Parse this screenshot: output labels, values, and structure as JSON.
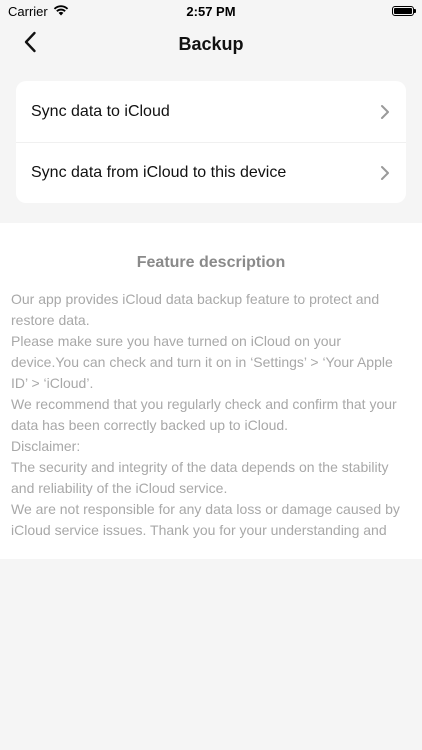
{
  "status_bar": {
    "carrier": "Carrier",
    "time": "2:57 PM"
  },
  "nav": {
    "title": "Backup",
    "back_icon": "chevron-left-icon"
  },
  "menu": {
    "items": [
      {
        "label": "Sync data to iCloud",
        "icon": "chevron-right-icon"
      },
      {
        "label": "Sync data from iCloud to this device",
        "icon": "chevron-right-icon"
      }
    ]
  },
  "description": {
    "title": "Feature description",
    "paragraphs": [
      "Our app provides iCloud data backup feature to protect and restore data.",
      "Please make sure you have turned on iCloud on your device.You can check and turn it on in ‘Settings’ > ‘Your Apple ID’ > ‘iCloud’.",
      "We recommend that you regularly check and confirm that your data has been correctly backed up to iCloud.",
      "Disclaimer:",
      "The security and integrity of the data depends on the stability and reliability of the iCloud service.",
      "We are not responsible for any data loss or damage caused by iCloud service issues. Thank you for your understanding and"
    ]
  },
  "colors": {
    "background": "#f5f5f5",
    "card": "#ffffff",
    "text_primary": "#111111",
    "text_muted": "#a8a8a8",
    "chevron": "#9a9a9a"
  }
}
